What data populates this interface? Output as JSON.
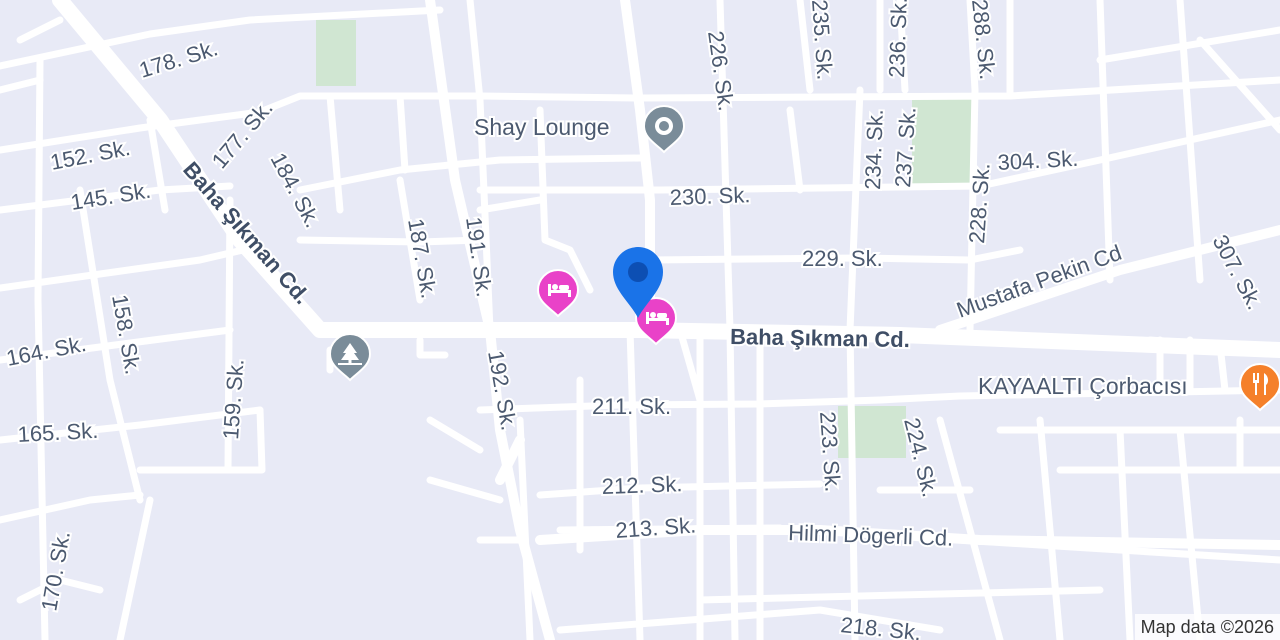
{
  "map": {
    "attribution": "Map data ©2026",
    "colors": {
      "land": "#e8eaf6",
      "road": "#ffffff",
      "park": "#d0e6d2",
      "label": "#4c5a70",
      "hotel_pin": "#e942c8",
      "restaurant_pin": "#f5802a",
      "landmark_pin": "#7a8c99",
      "location_pin": "#1a73e8"
    },
    "streets": {
      "s178": "178. Sk.",
      "s152": "152. Sk.",
      "s145": "145. Sk.",
      "s177": "177. Sk.",
      "baha_w": "Baha Şıkman Cd.",
      "s184": "184. Sk.",
      "s187": "187. Sk.",
      "s191": "191. Sk.",
      "s226": "226. Sk.",
      "s235": "235. Sk.",
      "s236": "236. Sk.",
      "s288": "288. Sk.",
      "s234": "234. Sk.",
      "s237": "237. Sk.",
      "s228": "228. Sk.",
      "s304": "304. Sk.",
      "s230": "230. Sk.",
      "s229": "229. Sk.",
      "mustafa": "Mustafa Pekin Cd",
      "s307": "307. Sk.",
      "baha_e": "Baha Şıkman Cd.",
      "s164": "164. Sk.",
      "s158": "158. Sk.",
      "s159": "159. Sk.",
      "s165": "165. Sk.",
      "s192": "192. Sk.",
      "s211": "211. Sk.",
      "s223": "223. Sk.",
      "s224": "224. Sk.",
      "s212": "212. Sk.",
      "s213": "213. Sk.",
      "hilmi": "Hilmi Dögerli Cd.",
      "s170": "170. Sk.",
      "s218": "218. Sk."
    },
    "pois": {
      "shay_lounge": "Shay Lounge",
      "kayaalti": "KAYAALTI Çorbacısı"
    },
    "icons": {
      "landmark": "landmark-icon",
      "hotel": "hotel-icon",
      "park": "park-icon",
      "restaurant": "fork-knife-icon",
      "location": "location-pin-icon"
    }
  }
}
